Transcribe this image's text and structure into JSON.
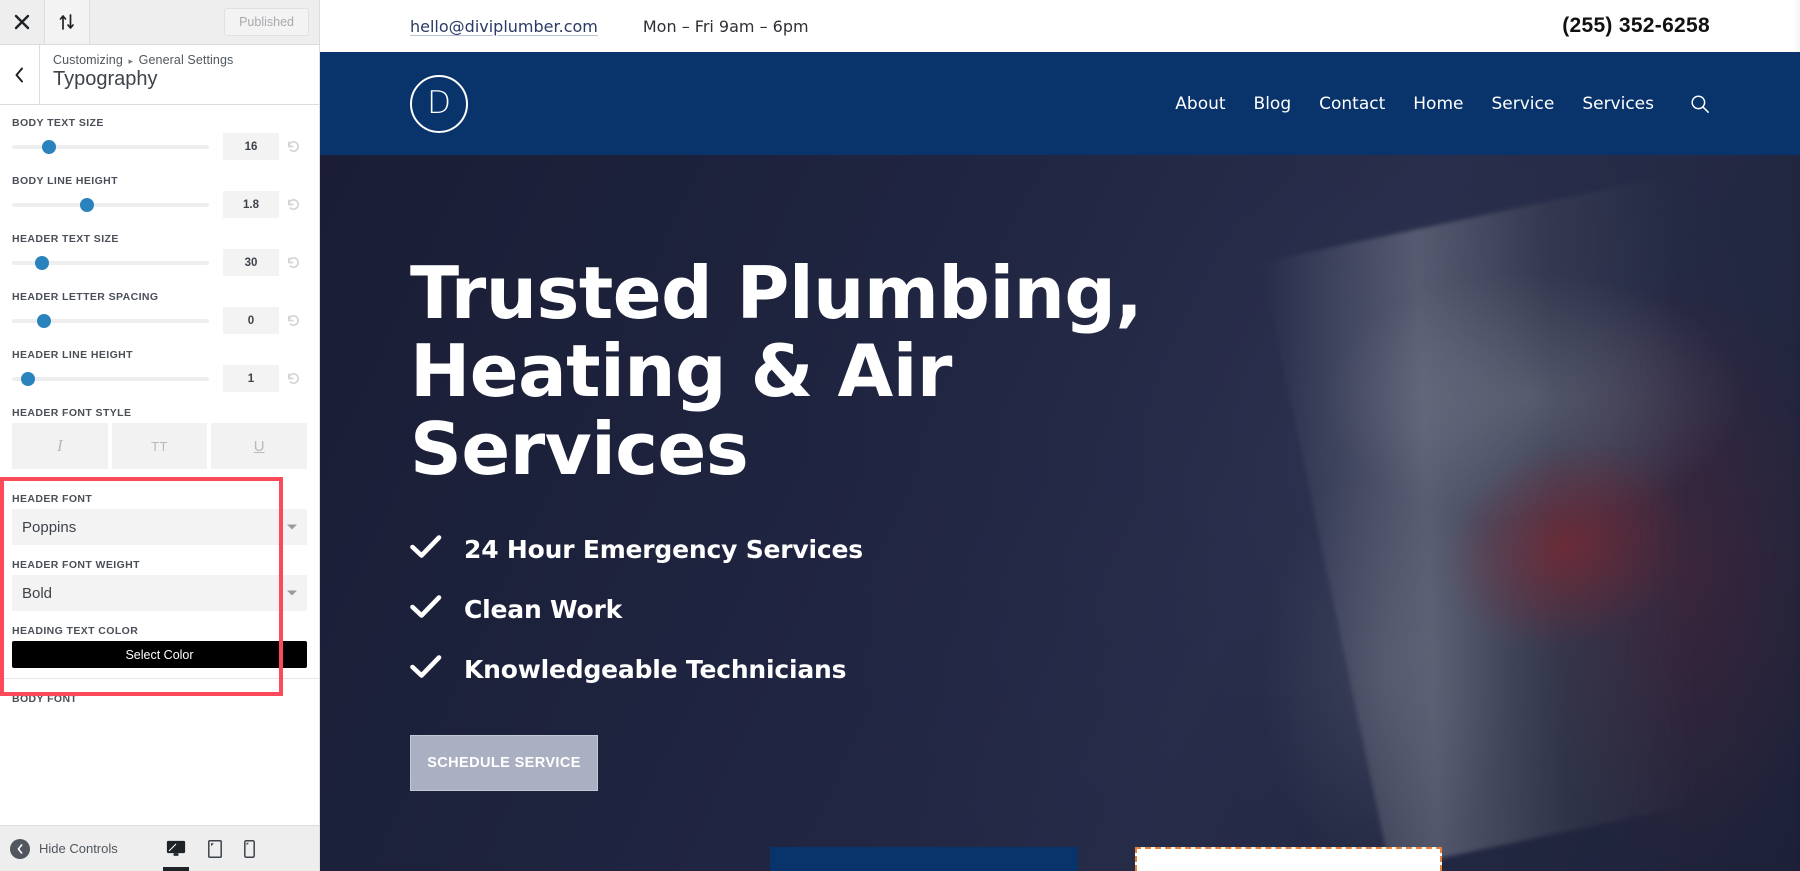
{
  "customizer": {
    "topbar": {
      "close_icon": "close-icon",
      "collapse_icon": "sort-updown-icon",
      "publish_label": "Published"
    },
    "header": {
      "back_icon": "chevron-left-icon",
      "breadcrumb_root": "Customizing",
      "breadcrumb_separator": "▸",
      "breadcrumb_parent": "General Settings",
      "section_title": "Typography"
    },
    "controls": [
      {
        "label": "BODY TEXT SIZE",
        "value": "16",
        "knob_pct": 19,
        "reset_icon": "reset-icon"
      },
      {
        "label": "BODY LINE HEIGHT",
        "value": "1.8",
        "knob_pct": 38,
        "reset_icon": "reset-icon"
      },
      {
        "label": "HEADER TEXT SIZE",
        "value": "30",
        "knob_pct": 15,
        "reset_icon": "reset-icon"
      },
      {
        "label": "HEADER LETTER SPACING",
        "value": "0",
        "knob_pct": 16,
        "reset_icon": "reset-icon"
      },
      {
        "label": "HEADER LINE HEIGHT",
        "value": "1",
        "knob_pct": 8,
        "reset_icon": "reset-icon"
      }
    ],
    "font_style": {
      "label": "HEADER FONT STYLE",
      "buttons": [
        {
          "name": "italic",
          "glyph": "I"
        },
        {
          "name": "uppercase",
          "glyph": "TT"
        },
        {
          "name": "underline",
          "glyph": "U"
        }
      ]
    },
    "header_font": {
      "label": "HEADER FONT",
      "value": "Poppins"
    },
    "header_font_weight": {
      "label": "HEADER FONT WEIGHT",
      "value": "Bold"
    },
    "heading_text_color": {
      "label": "HEADING TEXT COLOR",
      "button_label": "Select Color",
      "swatch": "#000000"
    },
    "body_font": {
      "label": "BODY FONT"
    },
    "footer": {
      "hide_controls_label": "Hide Controls",
      "devices": [
        {
          "name": "desktop",
          "active": true
        },
        {
          "name": "tablet",
          "active": false
        },
        {
          "name": "mobile",
          "active": false
        }
      ]
    },
    "highlight_color": "#fc4a5a"
  },
  "site": {
    "topbar": {
      "email": "hello@diviplumber.com",
      "hours": "Mon – Fri 9am – 6pm",
      "phone": "(255) 352-6258"
    },
    "nav": {
      "logo_letter": "D",
      "brand_color": "#09336b",
      "links": [
        "About",
        "Blog",
        "Contact",
        "Home",
        "Service",
        "Services"
      ],
      "search_icon": "search-icon"
    },
    "hero": {
      "title_line1": "Trusted Plumbing,",
      "title_line2": "Heating & Air Services",
      "bullets": [
        "24 Hour Emergency Services",
        "Clean Work",
        "Knowledgeable Technicians"
      ],
      "cta_label": "SCHEDULE SERVICE",
      "check_icon": "check-icon"
    },
    "bottom_strips": {
      "blue_color": "#09336b",
      "dashed_border_color": "#e8813a"
    }
  }
}
